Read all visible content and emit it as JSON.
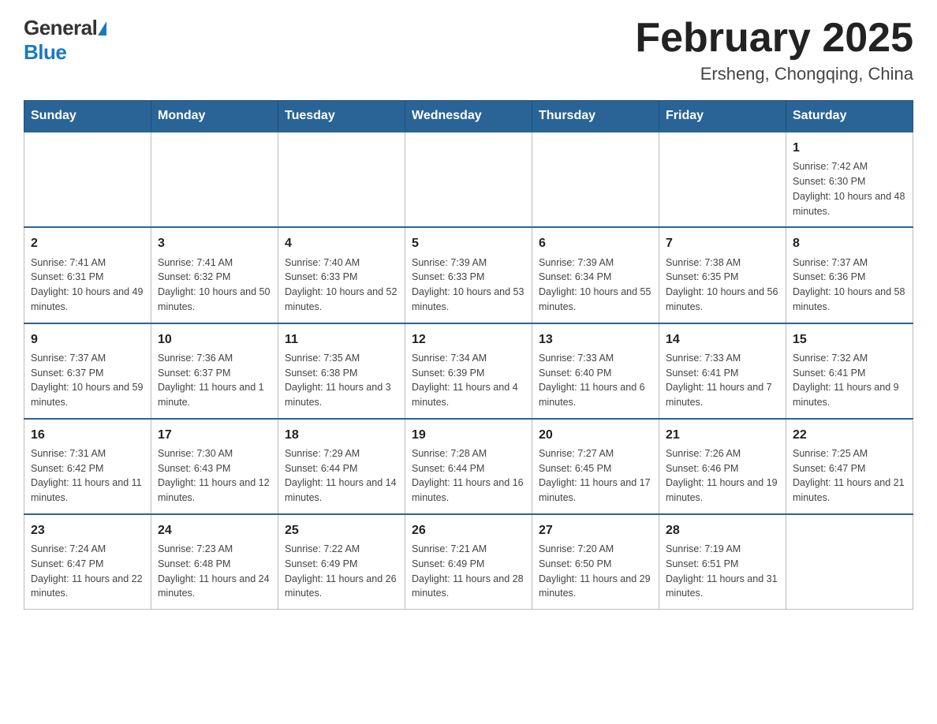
{
  "header": {
    "logo_general": "General",
    "logo_blue": "Blue",
    "title": "February 2025",
    "subtitle": "Ersheng, Chongqing, China"
  },
  "days_of_week": [
    "Sunday",
    "Monday",
    "Tuesday",
    "Wednesday",
    "Thursday",
    "Friday",
    "Saturday"
  ],
  "weeks": [
    {
      "days": [
        {
          "number": "",
          "info": ""
        },
        {
          "number": "",
          "info": ""
        },
        {
          "number": "",
          "info": ""
        },
        {
          "number": "",
          "info": ""
        },
        {
          "number": "",
          "info": ""
        },
        {
          "number": "",
          "info": ""
        },
        {
          "number": "1",
          "info": "Sunrise: 7:42 AM\nSunset: 6:30 PM\nDaylight: 10 hours and 48 minutes."
        }
      ]
    },
    {
      "days": [
        {
          "number": "2",
          "info": "Sunrise: 7:41 AM\nSunset: 6:31 PM\nDaylight: 10 hours and 49 minutes."
        },
        {
          "number": "3",
          "info": "Sunrise: 7:41 AM\nSunset: 6:32 PM\nDaylight: 10 hours and 50 minutes."
        },
        {
          "number": "4",
          "info": "Sunrise: 7:40 AM\nSunset: 6:33 PM\nDaylight: 10 hours and 52 minutes."
        },
        {
          "number": "5",
          "info": "Sunrise: 7:39 AM\nSunset: 6:33 PM\nDaylight: 10 hours and 53 minutes."
        },
        {
          "number": "6",
          "info": "Sunrise: 7:39 AM\nSunset: 6:34 PM\nDaylight: 10 hours and 55 minutes."
        },
        {
          "number": "7",
          "info": "Sunrise: 7:38 AM\nSunset: 6:35 PM\nDaylight: 10 hours and 56 minutes."
        },
        {
          "number": "8",
          "info": "Sunrise: 7:37 AM\nSunset: 6:36 PM\nDaylight: 10 hours and 58 minutes."
        }
      ]
    },
    {
      "days": [
        {
          "number": "9",
          "info": "Sunrise: 7:37 AM\nSunset: 6:37 PM\nDaylight: 10 hours and 59 minutes."
        },
        {
          "number": "10",
          "info": "Sunrise: 7:36 AM\nSunset: 6:37 PM\nDaylight: 11 hours and 1 minute."
        },
        {
          "number": "11",
          "info": "Sunrise: 7:35 AM\nSunset: 6:38 PM\nDaylight: 11 hours and 3 minutes."
        },
        {
          "number": "12",
          "info": "Sunrise: 7:34 AM\nSunset: 6:39 PM\nDaylight: 11 hours and 4 minutes."
        },
        {
          "number": "13",
          "info": "Sunrise: 7:33 AM\nSunset: 6:40 PM\nDaylight: 11 hours and 6 minutes."
        },
        {
          "number": "14",
          "info": "Sunrise: 7:33 AM\nSunset: 6:41 PM\nDaylight: 11 hours and 7 minutes."
        },
        {
          "number": "15",
          "info": "Sunrise: 7:32 AM\nSunset: 6:41 PM\nDaylight: 11 hours and 9 minutes."
        }
      ]
    },
    {
      "days": [
        {
          "number": "16",
          "info": "Sunrise: 7:31 AM\nSunset: 6:42 PM\nDaylight: 11 hours and 11 minutes."
        },
        {
          "number": "17",
          "info": "Sunrise: 7:30 AM\nSunset: 6:43 PM\nDaylight: 11 hours and 12 minutes."
        },
        {
          "number": "18",
          "info": "Sunrise: 7:29 AM\nSunset: 6:44 PM\nDaylight: 11 hours and 14 minutes."
        },
        {
          "number": "19",
          "info": "Sunrise: 7:28 AM\nSunset: 6:44 PM\nDaylight: 11 hours and 16 minutes."
        },
        {
          "number": "20",
          "info": "Sunrise: 7:27 AM\nSunset: 6:45 PM\nDaylight: 11 hours and 17 minutes."
        },
        {
          "number": "21",
          "info": "Sunrise: 7:26 AM\nSunset: 6:46 PM\nDaylight: 11 hours and 19 minutes."
        },
        {
          "number": "22",
          "info": "Sunrise: 7:25 AM\nSunset: 6:47 PM\nDaylight: 11 hours and 21 minutes."
        }
      ]
    },
    {
      "days": [
        {
          "number": "23",
          "info": "Sunrise: 7:24 AM\nSunset: 6:47 PM\nDaylight: 11 hours and 22 minutes."
        },
        {
          "number": "24",
          "info": "Sunrise: 7:23 AM\nSunset: 6:48 PM\nDaylight: 11 hours and 24 minutes."
        },
        {
          "number": "25",
          "info": "Sunrise: 7:22 AM\nSunset: 6:49 PM\nDaylight: 11 hours and 26 minutes."
        },
        {
          "number": "26",
          "info": "Sunrise: 7:21 AM\nSunset: 6:49 PM\nDaylight: 11 hours and 28 minutes."
        },
        {
          "number": "27",
          "info": "Sunrise: 7:20 AM\nSunset: 6:50 PM\nDaylight: 11 hours and 29 minutes."
        },
        {
          "number": "28",
          "info": "Sunrise: 7:19 AM\nSunset: 6:51 PM\nDaylight: 11 hours and 31 minutes."
        },
        {
          "number": "",
          "info": ""
        }
      ]
    }
  ]
}
